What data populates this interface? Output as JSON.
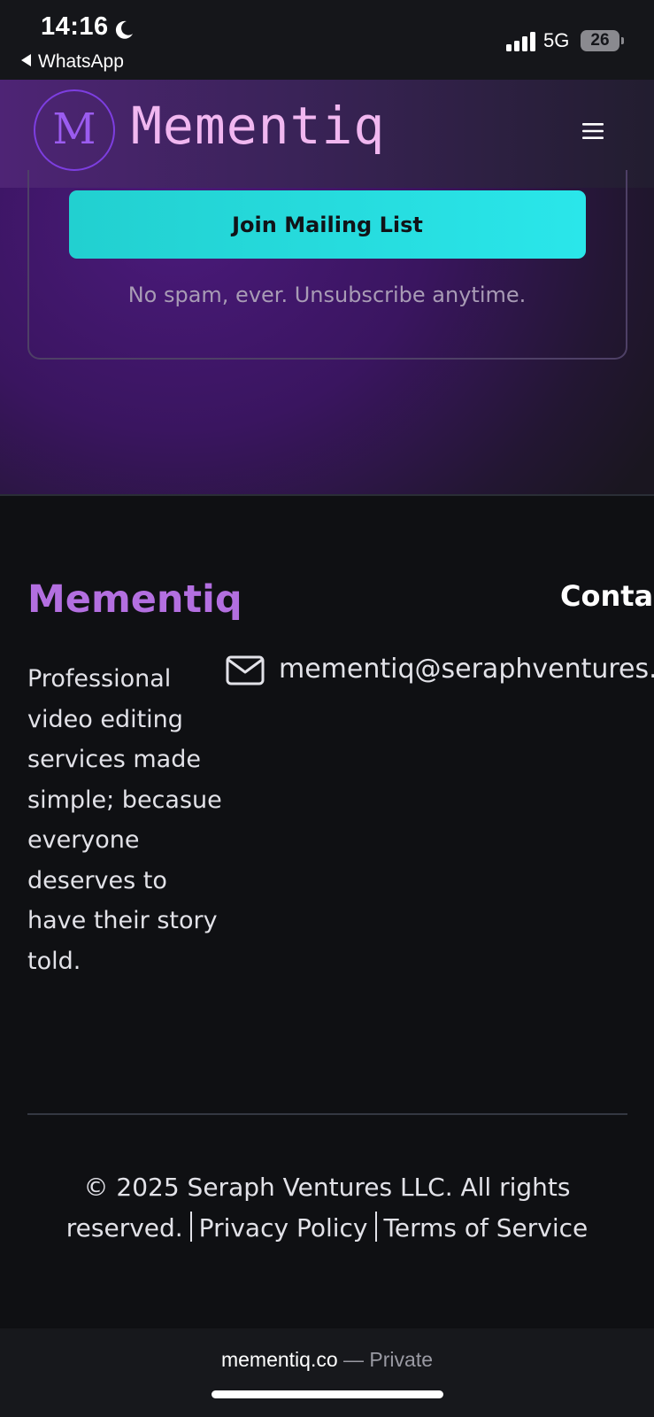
{
  "status_bar": {
    "time": "14:16",
    "back_app": "WhatsApp",
    "network": "5G",
    "battery": "26"
  },
  "header": {
    "logo_letter": "M",
    "brand": "Mementiq"
  },
  "mailing": {
    "button_label": "Join Mailing List",
    "note": "No spam, ever. Unsubscribe anytime."
  },
  "footer": {
    "brand": "Mementiq",
    "description": "Professional video editing services made simple; becasue everyone deserves to have their story told.",
    "contact_heading": "Contact",
    "email": "mementiq@seraphventures.net",
    "copyright": "© 2025 Seraph Ventures LLC. All rights reserved.",
    "privacy_label": "Privacy Policy",
    "terms_label": "Terms of Service"
  },
  "browser": {
    "url": "mementiq.co",
    "mode": "— Private"
  },
  "colors": {
    "accent_cyan": "#2ae6ea",
    "brand_purple": "#b36fe0",
    "logo_pink": "#f1b7f0"
  }
}
